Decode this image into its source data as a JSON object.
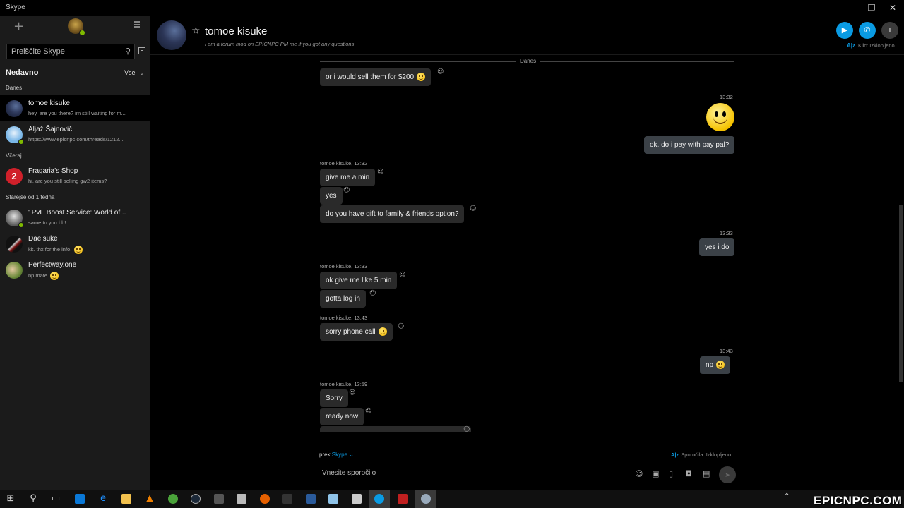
{
  "window": {
    "title": "Skype",
    "minimize": "—",
    "restore": "❐",
    "close": "✕"
  },
  "sidebar": {
    "add": "+",
    "search_placeholder": "Preiščite Skype",
    "recent_header": "Nedavno",
    "recent_filter": "Vse",
    "groups": {
      "today": "Danes",
      "yesterday": "Včeraj",
      "older": "Starejše od 1 tedna"
    },
    "conversations": [
      {
        "name": "tomoe kisuke",
        "preview": "hey. are you there? im still waiting for m...",
        "avatar_color": "#2b3556"
      },
      {
        "name": "Aljaž Šajnovič",
        "preview": "https://www.epicnpc.com/threads/1212...",
        "avatar_color": "#7ab7e8"
      },
      {
        "name": "Fragaria's Shop",
        "preview": "hi. are you still selling gw2 items?",
        "avatar_color": "#d0202a"
      },
      {
        "name": "' PvE Boost Service: World of...",
        "preview": "same to you bb!",
        "avatar_color": "#9a9a9a"
      },
      {
        "name": "Daeisuke",
        "preview": "kk. thx for the info.",
        "avatar_color": "#2a1a1a"
      },
      {
        "name": "Perfectway.one",
        "preview": "np mate",
        "avatar_color": "#6b8a3a"
      }
    ]
  },
  "header": {
    "name": "tomoe kisuke",
    "mood": "I am a forum mod on EPICNPC PM me if you got any questions",
    "call_status": "Klic: Izklopljeno",
    "status_icon": "A|z"
  },
  "chat": {
    "day": "Danes",
    "messages": [
      {
        "dir": "in",
        "text": "or i would sell them for $200",
        "emoji": true
      },
      {
        "dir": "out",
        "meta": "13:32",
        "big_emoji": true
      },
      {
        "dir": "out",
        "text": "ok. do i pay with pay pal?"
      },
      {
        "dir": "in",
        "meta": "tomoe kisuke, 13:32",
        "text": "give me a min"
      },
      {
        "dir": "in",
        "text": "yes"
      },
      {
        "dir": "in",
        "text": "do you have gift to family & friends option?"
      },
      {
        "dir": "out",
        "meta": "13:33",
        "text": "yes i do"
      },
      {
        "dir": "in",
        "meta": "tomoe kisuke, 13:33",
        "text": "ok give me like 5 min"
      },
      {
        "dir": "in",
        "text": "gotta log in"
      },
      {
        "dir": "in",
        "meta": "tomoe kisuke, 13:43",
        "text": "sorry phone call",
        "emoji": true
      },
      {
        "dir": "out",
        "meta": "13:43",
        "text": "np",
        "emoji": true
      },
      {
        "dir": "in",
        "meta": "tomoe kisuke, 13:59",
        "text": "Sorry"
      },
      {
        "dir": "in",
        "text": "ready now"
      }
    ]
  },
  "compose": {
    "via_prefix": "prek",
    "via_service": "Skype",
    "status": "Sporočila: Izklopljeno",
    "placeholder": "Vnesite sporočilo"
  },
  "taskbar": {
    "watermark": "EPICNPC.COM"
  },
  "colors": {
    "accent": "#0a9be3",
    "online": "#7fba00",
    "bubble_in": "#2a2a2a",
    "bubble_out": "#3b4147"
  }
}
